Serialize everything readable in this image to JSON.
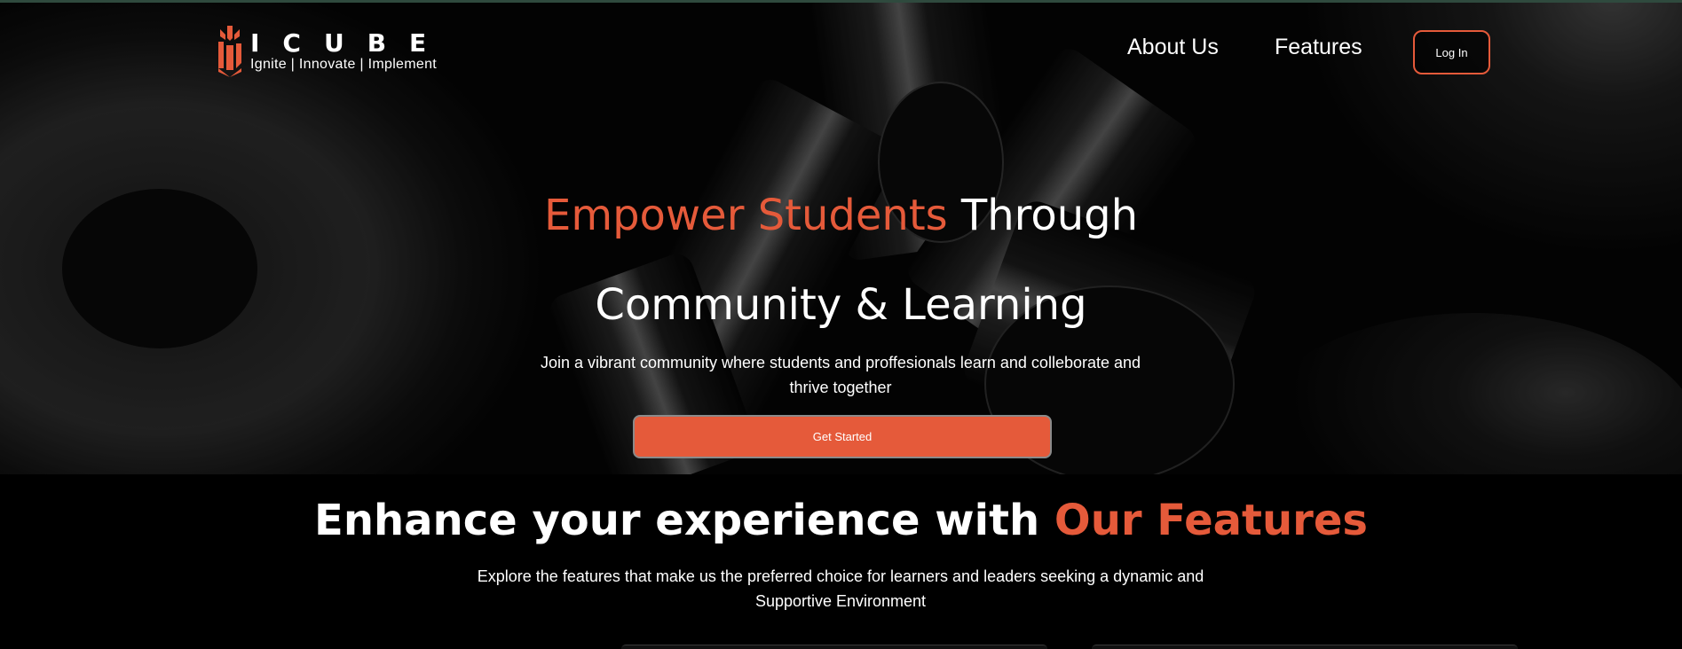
{
  "brand": {
    "name": "ICUBE",
    "tagline": "Ignite | Innovate | Implement",
    "accent_color": "#e55a3a",
    "logo_icon": "icube-logo-icon"
  },
  "nav": {
    "about": "About Us",
    "features": "Features",
    "login": "Log In"
  },
  "hero": {
    "title_line1_accent": "Empower Students",
    "title_line1_rest": " Through",
    "title_line2": "Community & Learning",
    "subtitle": "Join a vibrant community where students and proffesionals learn and colleborate and thrive together",
    "cta": "Get Started"
  },
  "features": {
    "title_prefix": "Enhance your experience with ",
    "title_accent": "Our Features",
    "subtitle": "Explore the features that make us the preferred choice for learners and leaders seeking a dynamic and Supportive Environment"
  }
}
